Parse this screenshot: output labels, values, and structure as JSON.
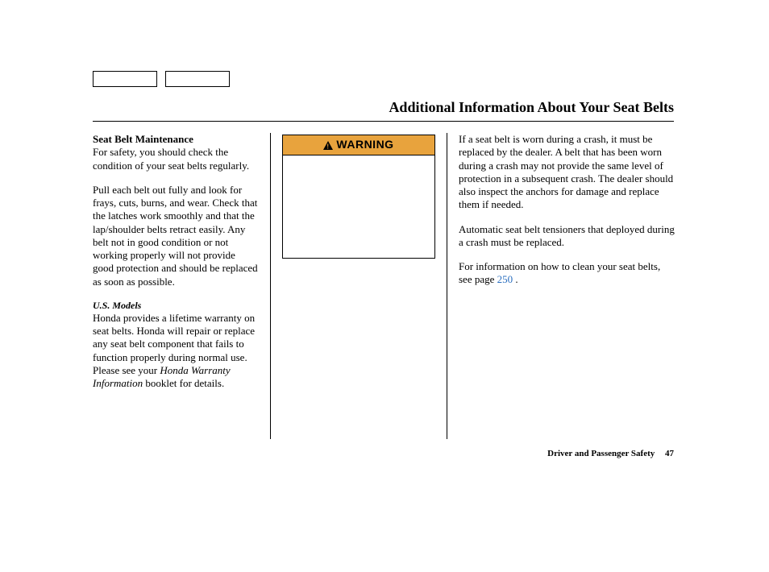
{
  "title": "Additional Information About Your Seat Belts",
  "left": {
    "heading": "Seat Belt Maintenance",
    "p1": "For safety, you should check the condition of your seat belts regularly.",
    "p2": "Pull each belt out fully and look for frays, cuts, burns, and wear. Check that the latches work smoothly and that the lap/shoulder belts retract easily. Any belt not in good condition or not working properly will not provide good protection and should be replaced as soon as possible.",
    "subheading": "U.S. Models",
    "p3a": "Honda provides a lifetime warranty on seat belts. Honda will repair or replace any seat belt component that fails to function properly during normal use. Please see your ",
    "p3b_italic": "Honda Warranty Information",
    "p3c": " booklet for details."
  },
  "warning": {
    "label": "WARNING"
  },
  "right": {
    "p1": "If a seat belt is worn during a crash, it must be replaced by the dealer. A belt that has been worn during a crash may not provide the same level of protection in a subsequent crash. The dealer should also inspect the anchors for damage and replace them if needed.",
    "p2": "Automatic seat belt tensioners that deployed during a crash must be replaced.",
    "p3a": "For information on how to clean your seat belts, see page ",
    "p3_link": "250",
    "p3b": " ."
  },
  "footer": {
    "section": "Driver and Passenger Safety",
    "page": "47"
  }
}
